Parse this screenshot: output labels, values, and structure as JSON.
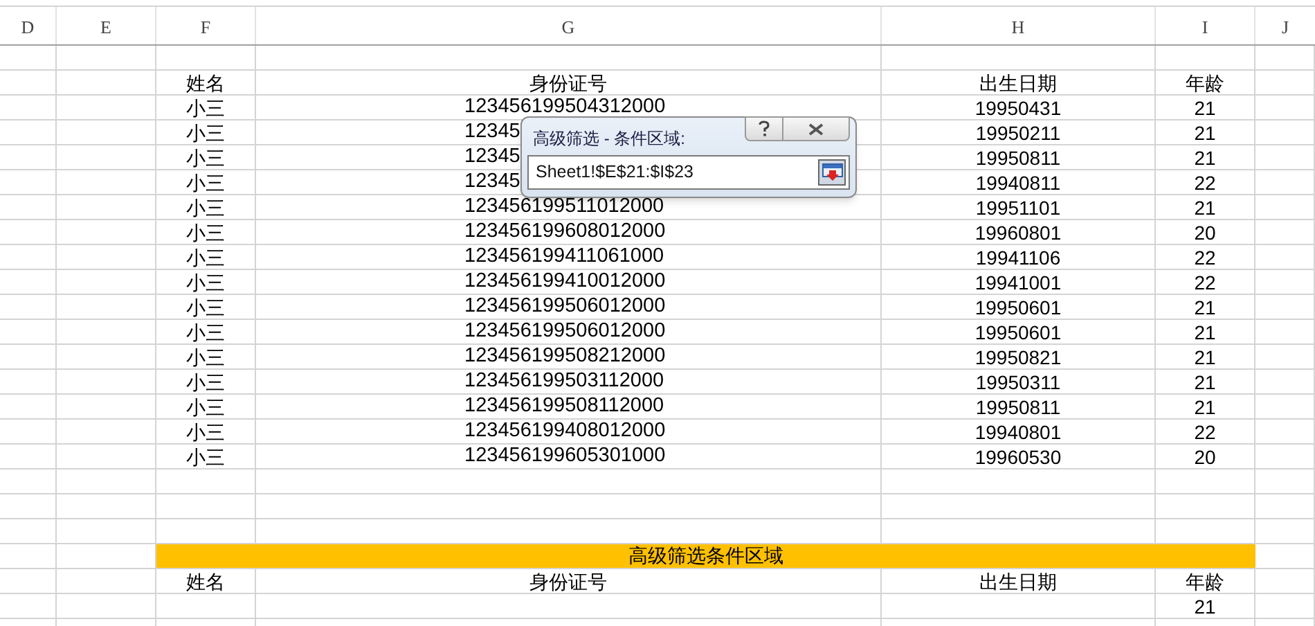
{
  "columns": [
    "D",
    "E",
    "F",
    "G",
    "H",
    "I",
    "J"
  ],
  "header": {
    "name": "姓名",
    "id": "身份证号",
    "birth": "出生日期",
    "age": "年龄"
  },
  "rows": [
    {
      "name": "小三",
      "id": "123456199504312000",
      "birth": "19950431",
      "age": "21"
    },
    {
      "name": "小三",
      "id": "12345",
      "birth": "19950211",
      "age": "21"
    },
    {
      "name": "小三",
      "id": "12345",
      "birth": "19950811",
      "age": "21"
    },
    {
      "name": "小三",
      "id": "12345",
      "birth": "19940811",
      "age": "22"
    },
    {
      "name": "小三",
      "id": "123456199511012000",
      "birth": "19951101",
      "age": "21"
    },
    {
      "name": "小三",
      "id": "123456199608012000",
      "birth": "19960801",
      "age": "20"
    },
    {
      "name": "小三",
      "id": "123456199411061000",
      "birth": "19941106",
      "age": "22"
    },
    {
      "name": "小三",
      "id": "123456199410012000",
      "birth": "19941001",
      "age": "22"
    },
    {
      "name": "小三",
      "id": "123456199506012000",
      "birth": "19950601",
      "age": "21"
    },
    {
      "name": "小三",
      "id": "123456199506012000",
      "birth": "19950601",
      "age": "21"
    },
    {
      "name": "小三",
      "id": "123456199508212000",
      "birth": "19950821",
      "age": "21"
    },
    {
      "name": "小三",
      "id": "123456199503112000",
      "birth": "19950311",
      "age": "21"
    },
    {
      "name": "小三",
      "id": "123456199508112000",
      "birth": "19950811",
      "age": "21"
    },
    {
      "name": "小三",
      "id": "123456199408012000",
      "birth": "19940801",
      "age": "22"
    },
    {
      "name": "小三",
      "id": "123456199605301000",
      "birth": "19960530",
      "age": "20"
    }
  ],
  "criteria": {
    "title": "高级筛选条件区域",
    "header": {
      "name": "姓名",
      "id": "身份证号",
      "birth": "出生日期",
      "age": "年龄"
    },
    "rows": [
      {
        "age": "21"
      }
    ]
  },
  "dialog": {
    "title": "高级筛选 - 条件区域:",
    "value": "Sheet1!$E$21:$I$23"
  }
}
